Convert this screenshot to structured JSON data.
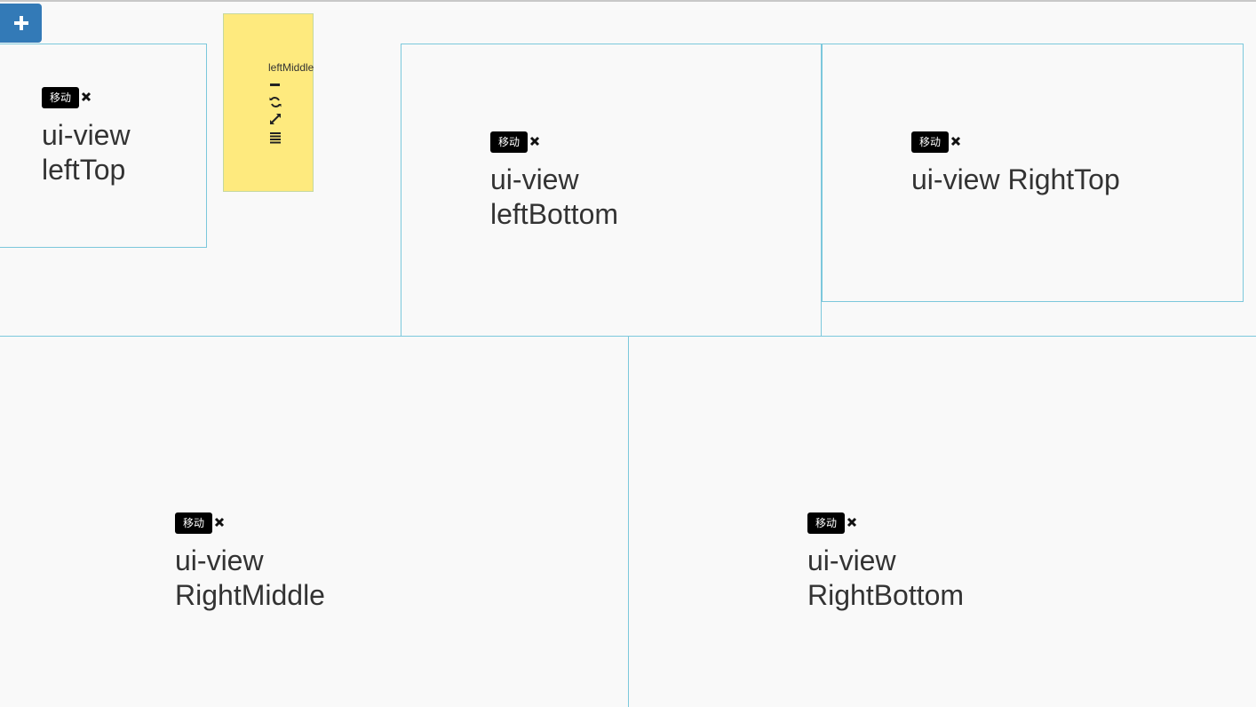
{
  "add_button": {
    "icon": "plus-icon"
  },
  "widget": {
    "title": "leftMiddle",
    "tools": [
      "minus-icon",
      "refresh-icon",
      "expand-icon",
      "list-icon"
    ],
    "color": "#feea7e"
  },
  "panels": {
    "leftTop": {
      "move_label": "移动",
      "title": "ui-view leftTop"
    },
    "leftBottom": {
      "move_label": "移动",
      "title": "ui-view leftBottom"
    },
    "rightTop": {
      "move_label": "移动",
      "title": "ui-view RightTop"
    },
    "rightMiddle": {
      "move_label": "移动",
      "title": "ui-view RightMiddle"
    },
    "rightBottom": {
      "move_label": "移动",
      "title": "ui-view RightBottom"
    }
  },
  "colors": {
    "accent": "#337ab7",
    "border": "#7cc8dc",
    "background": "#f9f9f9"
  }
}
